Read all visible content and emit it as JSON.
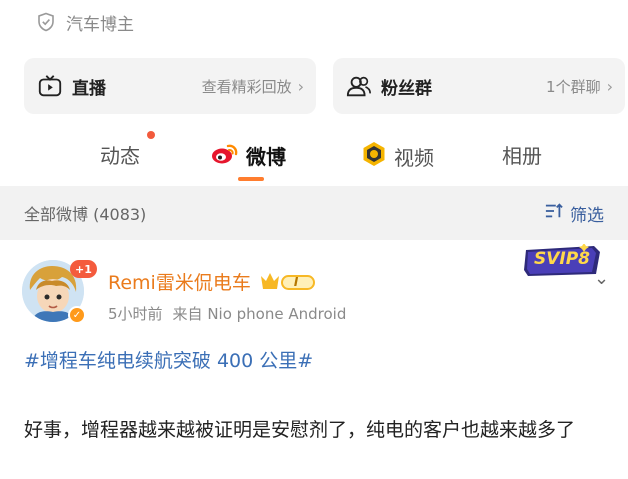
{
  "profile": {
    "verified_label": "汽车博主"
  },
  "cards": {
    "live": {
      "title": "直播",
      "action": "查看精彩回放",
      "icon": "tv-icon"
    },
    "fans": {
      "title": "粉丝群",
      "action": "1个群聊",
      "icon": "group-icon"
    }
  },
  "tabs": [
    {
      "label": "动态"
    },
    {
      "label": "微博"
    },
    {
      "label": "视频"
    },
    {
      "label": "相册"
    }
  ],
  "filter_bar": {
    "count_label": "全部微博 (4083)",
    "filter_label": "筛选"
  },
  "post": {
    "username": "Remi雷米侃电车",
    "avatar_badge": "+1",
    "vip_level": "I",
    "time": "5小时前",
    "source": "来自 Nio phone Android",
    "svip_label": "SVIP8",
    "topic": "#增程车纯电续航突破 400 公里#",
    "text": "好事，增程器越来越被证明是安慰剂了，纯电的客户也越来越多了"
  },
  "colors": {
    "accent_orange": "#ff7d2e",
    "link_blue": "#3b6fb6",
    "username_orange": "#ea7b1c"
  }
}
